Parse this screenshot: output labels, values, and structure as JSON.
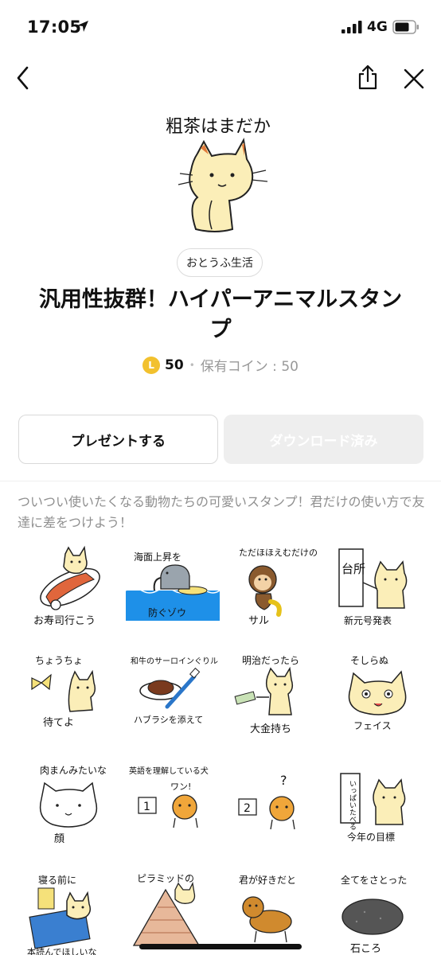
{
  "status_bar": {
    "time": "17:05",
    "network": "4G"
  },
  "nav": {},
  "product": {
    "art_caption": "粗茶はまだか",
    "author": "おとうふ生活",
    "title": "汎用性抜群！ハイパーアニマルスタンプ",
    "coin_letter": "L",
    "price": "50",
    "owned_coins": "保有コイン : 50"
  },
  "actions": {
    "present_label": "プレゼントする",
    "downloaded_label": "ダウンロード済み"
  },
  "description": "ついつい使いたくなる動物たちの可愛いスタンプ！君だけの使い方で友達に差をつけよう！",
  "stickers": [
    {
      "texts": [
        "お寿司行こう"
      ]
    },
    {
      "texts": [
        "海面上昇を",
        "防ぐゾウ"
      ]
    },
    {
      "texts": [
        "ただほほえむだけの",
        "サル"
      ]
    },
    {
      "texts": [
        "台所",
        "新元号発表"
      ]
    },
    {
      "texts": [
        "ちょうちょ",
        "待てよ"
      ]
    },
    {
      "texts": [
        "和牛のサーロインぐりル",
        "ハブラシを添えて"
      ]
    },
    {
      "texts": [
        "明治だったら",
        "大金持ち"
      ]
    },
    {
      "texts": [
        "そしらぬ",
        "フェイス"
      ]
    },
    {
      "texts": [
        "肉まんみたいな",
        "顔"
      ]
    },
    {
      "texts": [
        "英語を理解している犬",
        "ワン!",
        "1",
        "2"
      ]
    },
    {
      "texts": [
        "?"
      ]
    },
    {
      "texts": [
        "いっぱいたべる",
        "今年の目標"
      ]
    },
    {
      "texts": [
        "寝る前に",
        "本読んでほしいな"
      ]
    },
    {
      "texts": [
        "ピラミッドの"
      ]
    },
    {
      "texts": [
        "君が好きだと"
      ]
    },
    {
      "texts": [
        "全てをさとった",
        "石ころ"
      ]
    }
  ],
  "colors": {
    "accent_coin": "#f2c12e",
    "cat_fill": "#fbeeb8",
    "sea": "#1e90e8",
    "elephant": "#9aa4ad"
  }
}
